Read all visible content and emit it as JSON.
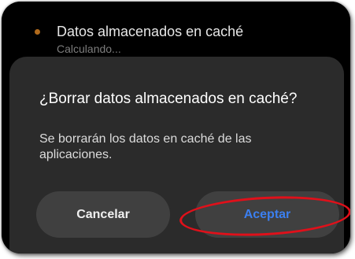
{
  "background_setting": {
    "title": "Datos almacenados en caché",
    "subtitle": "Calculando..."
  },
  "dialog": {
    "title": "¿Borrar datos almacenados en caché?",
    "message": "Se borrarán los datos en caché de las aplicaciones.",
    "cancel_label": "Cancelar",
    "accept_label": "Aceptar"
  },
  "colors": {
    "accent": "#3b7ff0",
    "annotation": "#e0101a",
    "dialog_bg": "#2b2b2b",
    "button_bg": "#404040",
    "bullet": "#b06a1c"
  }
}
